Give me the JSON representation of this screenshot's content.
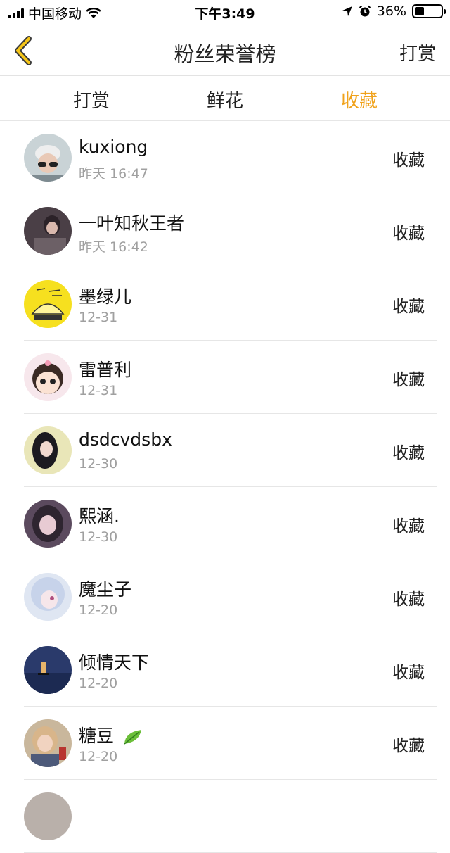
{
  "status_bar": {
    "carrier": "中国移动",
    "time": "下午3:49",
    "battery": "36%",
    "battery_level": 0.36
  },
  "nav": {
    "title": "粉丝荣誉榜",
    "action": "打赏"
  },
  "tabs": [
    {
      "label": "打赏",
      "active": false
    },
    {
      "label": "鲜花",
      "active": false
    },
    {
      "label": "收藏",
      "active": true
    }
  ],
  "accent_color": "#f0a21b",
  "fans": [
    {
      "name": "kuxiong",
      "time": "昨天 16:47",
      "action": "收藏"
    },
    {
      "name": "一叶知秋王者",
      "time": "昨天 16:42",
      "action": "收藏"
    },
    {
      "name": "墨绿儿",
      "time": "12-31",
      "action": "收藏"
    },
    {
      "name": "雷普利",
      "time": "12-31",
      "action": "收藏"
    },
    {
      "name": "dsdcvdsbx",
      "time": "12-30",
      "action": "收藏"
    },
    {
      "name": "熙涵.",
      "time": "12-30",
      "action": "收藏"
    },
    {
      "name": "魔尘子",
      "time": "12-20",
      "action": "收藏"
    },
    {
      "name": "倾情天下",
      "time": "12-20",
      "action": "收藏"
    },
    {
      "name": "糖豆",
      "time": "12-20",
      "action": "收藏",
      "icon": "leaf-icon"
    }
  ]
}
